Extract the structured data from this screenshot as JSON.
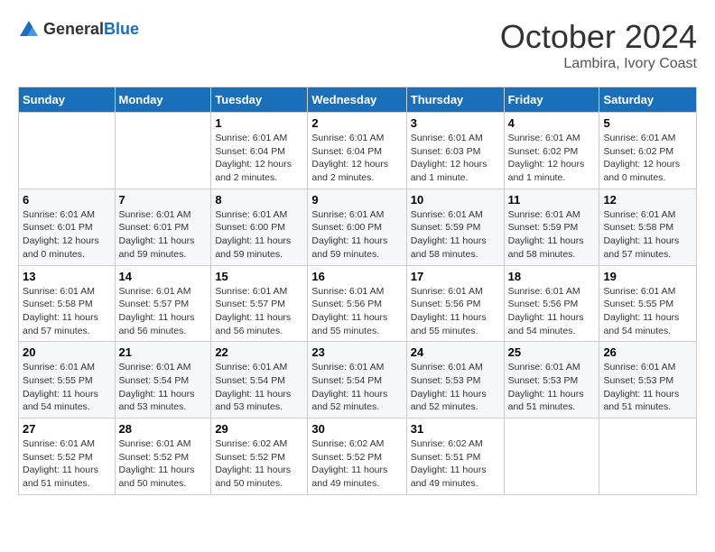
{
  "logo": {
    "general": "General",
    "blue": "Blue"
  },
  "title": "October 2024",
  "location": "Lambira, Ivory Coast",
  "days_header": [
    "Sunday",
    "Monday",
    "Tuesday",
    "Wednesday",
    "Thursday",
    "Friday",
    "Saturday"
  ],
  "weeks": [
    [
      {
        "day": "",
        "info": ""
      },
      {
        "day": "",
        "info": ""
      },
      {
        "day": "1",
        "info": "Sunrise: 6:01 AM\nSunset: 6:04 PM\nDaylight: 12 hours and 2 minutes."
      },
      {
        "day": "2",
        "info": "Sunrise: 6:01 AM\nSunset: 6:04 PM\nDaylight: 12 hours and 2 minutes."
      },
      {
        "day": "3",
        "info": "Sunrise: 6:01 AM\nSunset: 6:03 PM\nDaylight: 12 hours and 1 minute."
      },
      {
        "day": "4",
        "info": "Sunrise: 6:01 AM\nSunset: 6:02 PM\nDaylight: 12 hours and 1 minute."
      },
      {
        "day": "5",
        "info": "Sunrise: 6:01 AM\nSunset: 6:02 PM\nDaylight: 12 hours and 0 minutes."
      }
    ],
    [
      {
        "day": "6",
        "info": "Sunrise: 6:01 AM\nSunset: 6:01 PM\nDaylight: 12 hours and 0 minutes."
      },
      {
        "day": "7",
        "info": "Sunrise: 6:01 AM\nSunset: 6:01 PM\nDaylight: 11 hours and 59 minutes."
      },
      {
        "day": "8",
        "info": "Sunrise: 6:01 AM\nSunset: 6:00 PM\nDaylight: 11 hours and 59 minutes."
      },
      {
        "day": "9",
        "info": "Sunrise: 6:01 AM\nSunset: 6:00 PM\nDaylight: 11 hours and 59 minutes."
      },
      {
        "day": "10",
        "info": "Sunrise: 6:01 AM\nSunset: 5:59 PM\nDaylight: 11 hours and 58 minutes."
      },
      {
        "day": "11",
        "info": "Sunrise: 6:01 AM\nSunset: 5:59 PM\nDaylight: 11 hours and 58 minutes."
      },
      {
        "day": "12",
        "info": "Sunrise: 6:01 AM\nSunset: 5:58 PM\nDaylight: 11 hours and 57 minutes."
      }
    ],
    [
      {
        "day": "13",
        "info": "Sunrise: 6:01 AM\nSunset: 5:58 PM\nDaylight: 11 hours and 57 minutes."
      },
      {
        "day": "14",
        "info": "Sunrise: 6:01 AM\nSunset: 5:57 PM\nDaylight: 11 hours and 56 minutes."
      },
      {
        "day": "15",
        "info": "Sunrise: 6:01 AM\nSunset: 5:57 PM\nDaylight: 11 hours and 56 minutes."
      },
      {
        "day": "16",
        "info": "Sunrise: 6:01 AM\nSunset: 5:56 PM\nDaylight: 11 hours and 55 minutes."
      },
      {
        "day": "17",
        "info": "Sunrise: 6:01 AM\nSunset: 5:56 PM\nDaylight: 11 hours and 55 minutes."
      },
      {
        "day": "18",
        "info": "Sunrise: 6:01 AM\nSunset: 5:56 PM\nDaylight: 11 hours and 54 minutes."
      },
      {
        "day": "19",
        "info": "Sunrise: 6:01 AM\nSunset: 5:55 PM\nDaylight: 11 hours and 54 minutes."
      }
    ],
    [
      {
        "day": "20",
        "info": "Sunrise: 6:01 AM\nSunset: 5:55 PM\nDaylight: 11 hours and 54 minutes."
      },
      {
        "day": "21",
        "info": "Sunrise: 6:01 AM\nSunset: 5:54 PM\nDaylight: 11 hours and 53 minutes."
      },
      {
        "day": "22",
        "info": "Sunrise: 6:01 AM\nSunset: 5:54 PM\nDaylight: 11 hours and 53 minutes."
      },
      {
        "day": "23",
        "info": "Sunrise: 6:01 AM\nSunset: 5:54 PM\nDaylight: 11 hours and 52 minutes."
      },
      {
        "day": "24",
        "info": "Sunrise: 6:01 AM\nSunset: 5:53 PM\nDaylight: 11 hours and 52 minutes."
      },
      {
        "day": "25",
        "info": "Sunrise: 6:01 AM\nSunset: 5:53 PM\nDaylight: 11 hours and 51 minutes."
      },
      {
        "day": "26",
        "info": "Sunrise: 6:01 AM\nSunset: 5:53 PM\nDaylight: 11 hours and 51 minutes."
      }
    ],
    [
      {
        "day": "27",
        "info": "Sunrise: 6:01 AM\nSunset: 5:52 PM\nDaylight: 11 hours and 51 minutes."
      },
      {
        "day": "28",
        "info": "Sunrise: 6:01 AM\nSunset: 5:52 PM\nDaylight: 11 hours and 50 minutes."
      },
      {
        "day": "29",
        "info": "Sunrise: 6:02 AM\nSunset: 5:52 PM\nDaylight: 11 hours and 50 minutes."
      },
      {
        "day": "30",
        "info": "Sunrise: 6:02 AM\nSunset: 5:52 PM\nDaylight: 11 hours and 49 minutes."
      },
      {
        "day": "31",
        "info": "Sunrise: 6:02 AM\nSunset: 5:51 PM\nDaylight: 11 hours and 49 minutes."
      },
      {
        "day": "",
        "info": ""
      },
      {
        "day": "",
        "info": ""
      }
    ]
  ]
}
